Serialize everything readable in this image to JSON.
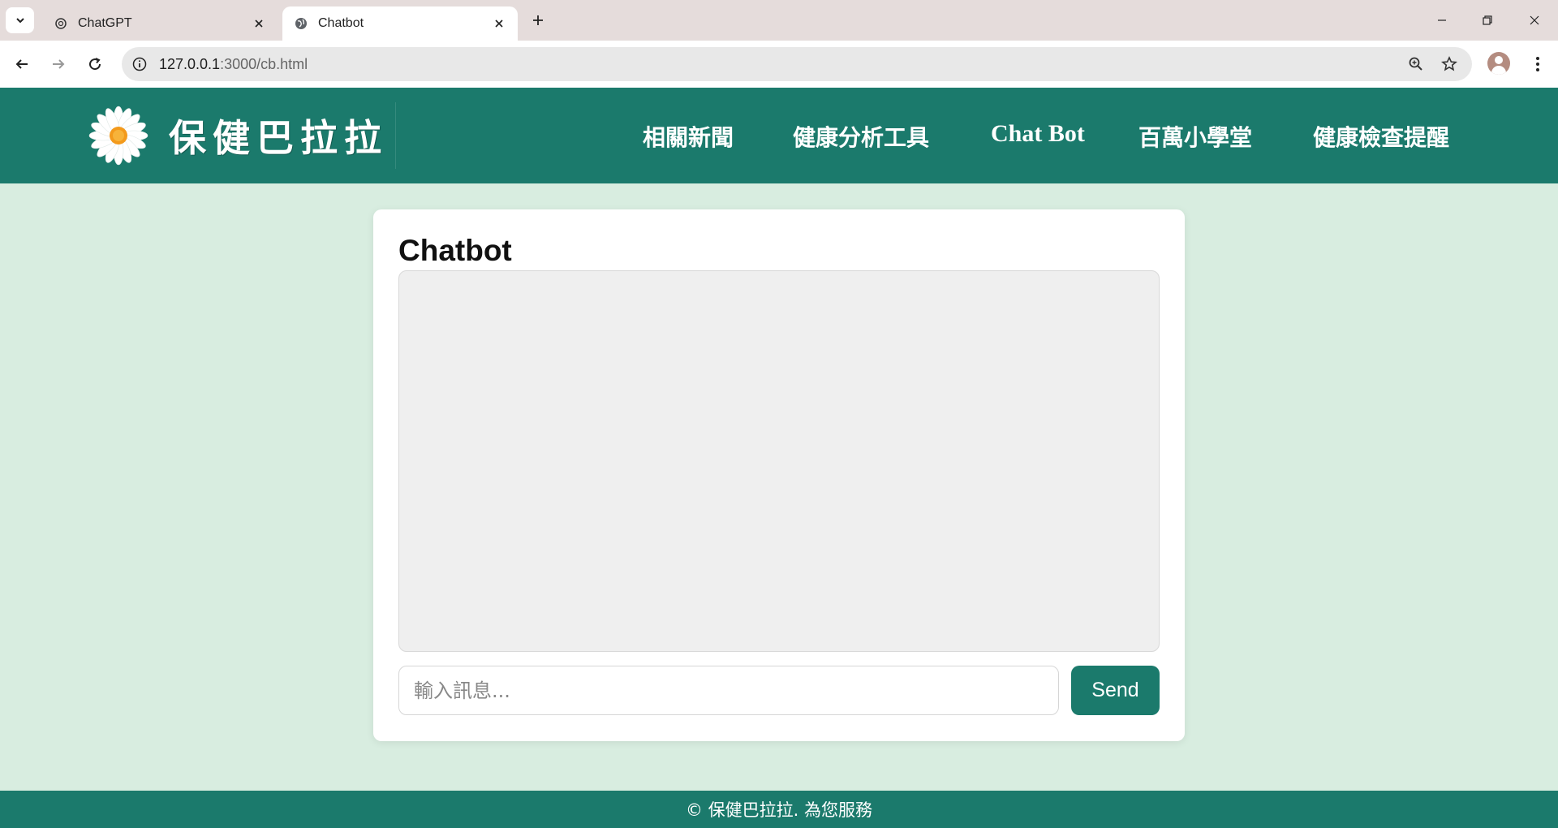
{
  "browser": {
    "tabs": [
      {
        "title": "ChatGPT",
        "favicon": "openai-icon"
      },
      {
        "title": "Chatbot",
        "favicon": "globe-icon",
        "active": true
      }
    ],
    "url_host": "127.0.0.1",
    "url_path": ":3000/cb.html"
  },
  "header": {
    "brand": "保健巴拉拉",
    "nav": [
      {
        "label": "相關新聞"
      },
      {
        "label": "健康分析工具"
      },
      {
        "label": "Chat Bot"
      },
      {
        "label": "百萬小學堂"
      },
      {
        "label": "健康檢查提醒"
      }
    ]
  },
  "chat": {
    "title": "Chatbot",
    "input_placeholder": "輸入訊息...",
    "input_value": "",
    "send_label": "Send"
  },
  "footer": {
    "text": "© 保健巴拉拉. 為您服務"
  },
  "colors": {
    "brand_green": "#1b7a6c",
    "page_background": "#d8ede0",
    "chat_log_background": "#efefef"
  }
}
